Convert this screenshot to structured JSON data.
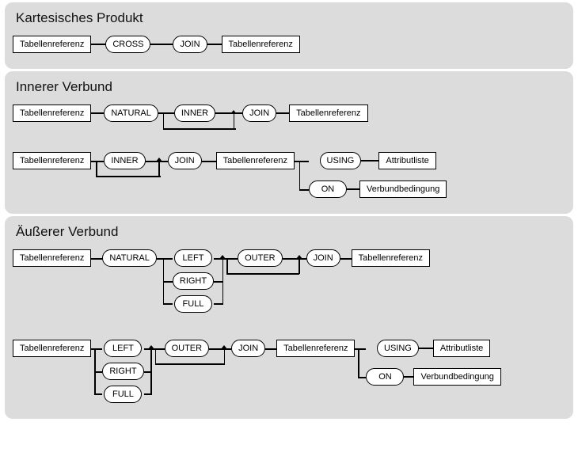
{
  "panels": [
    {
      "title": "Kartesisches Produkt"
    },
    {
      "title": "Innerer Verbund"
    },
    {
      "title": "Äußerer Verbund"
    }
  ],
  "rect": {
    "table": "Tabellenreferenz",
    "attrlist": "Attributliste",
    "cond": "Verbundbedingung"
  },
  "pill": {
    "cross": "CROSS",
    "join": "JOIN",
    "natural": "NATURAL",
    "inner": "INNER",
    "using": "USING",
    "on": "ON",
    "left": "LEFT",
    "right": "RIGHT",
    "full": "FULL",
    "outer": "OUTER"
  }
}
